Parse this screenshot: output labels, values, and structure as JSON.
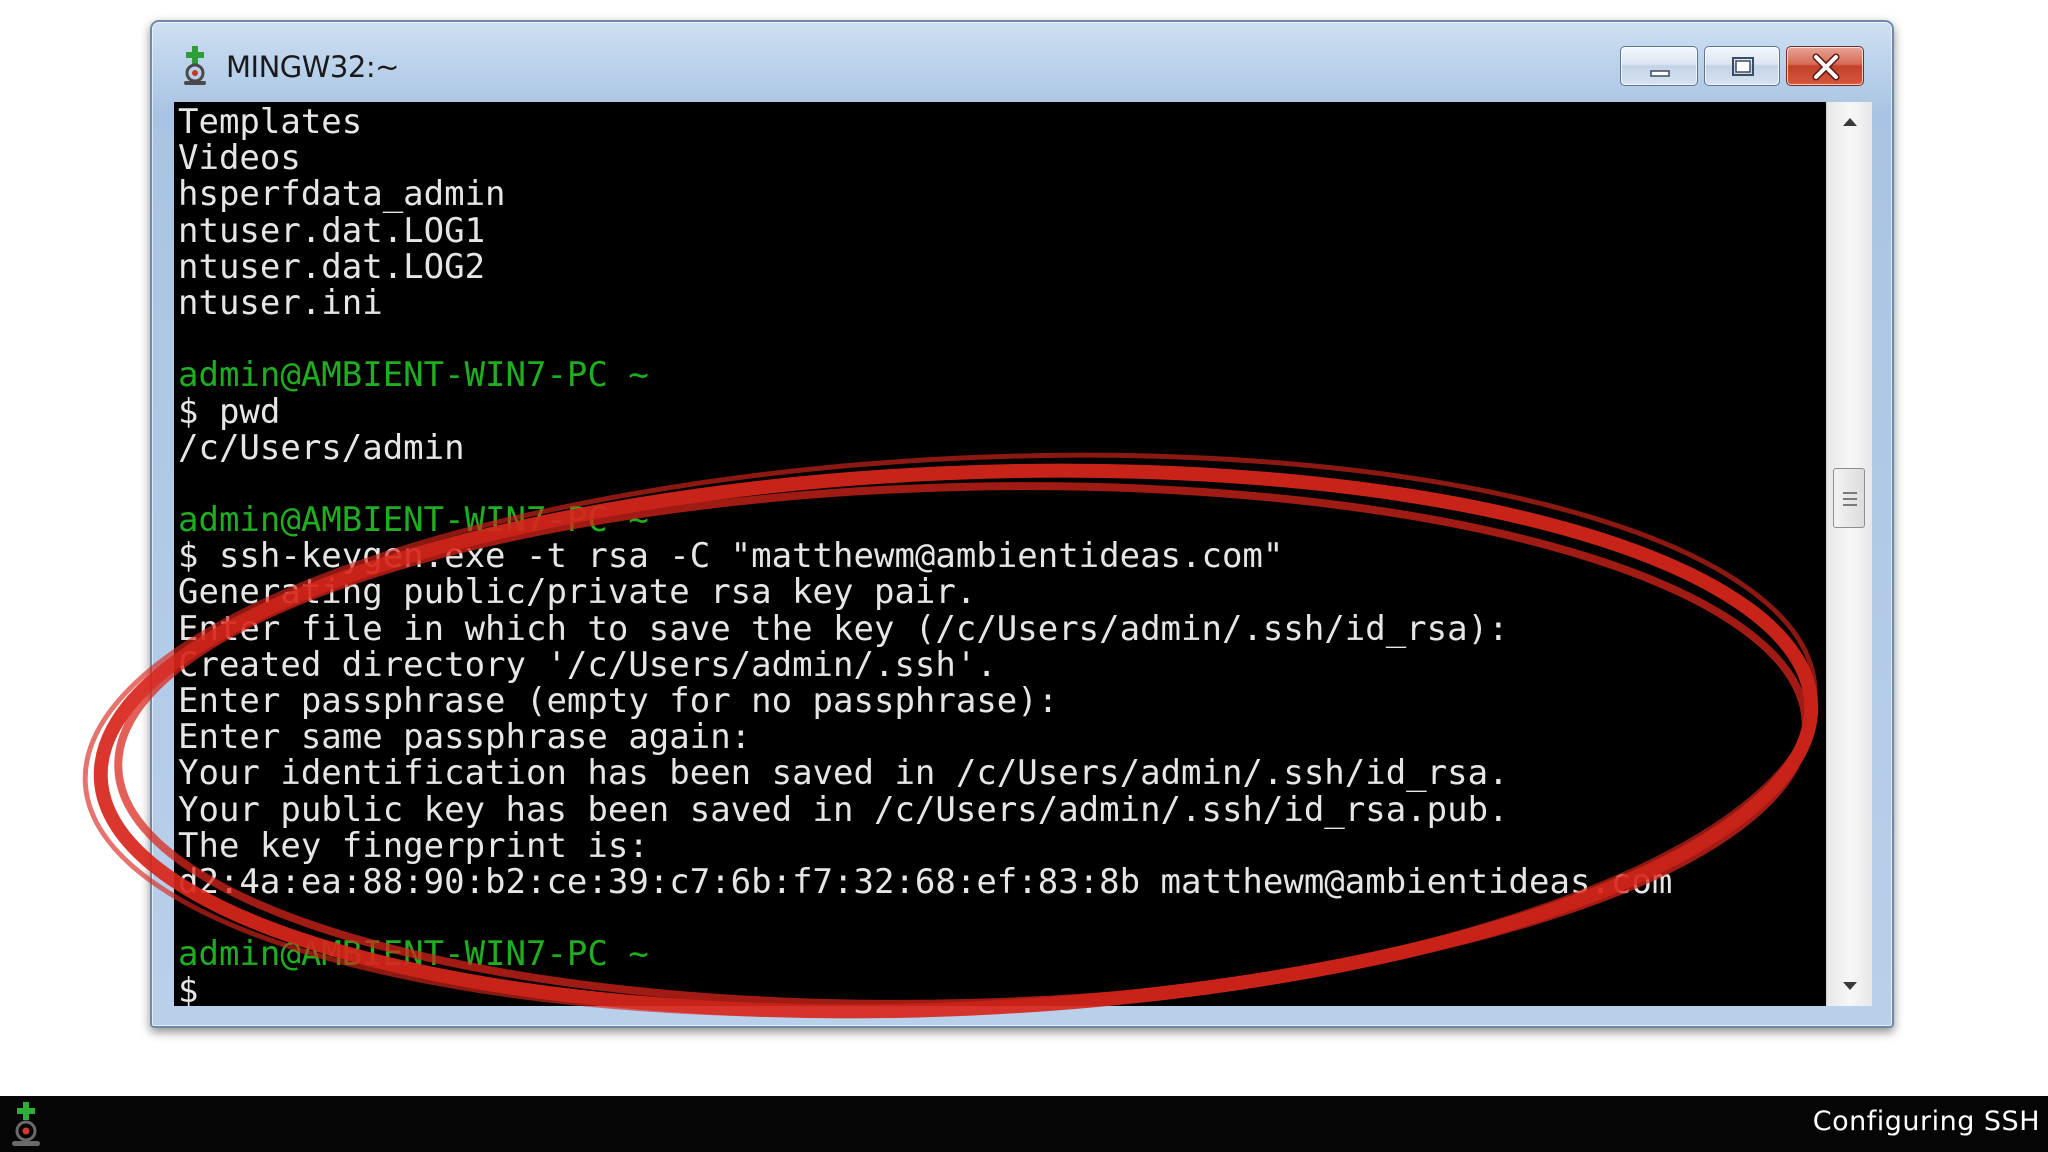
{
  "window": {
    "title": "MINGW32:~",
    "icon": "git-bash-icon",
    "buttons": {
      "minimize": "minimize-icon",
      "maximize": "maximize-icon",
      "close": "close-icon"
    },
    "colors": {
      "close_button": "#c1402a",
      "console_background": "#000000",
      "console_text": "#e6e6e6",
      "prompt_text": "#1fae1f"
    }
  },
  "console": {
    "lines": [
      {
        "text": "Templates",
        "kind": "output"
      },
      {
        "text": "Videos",
        "kind": "output"
      },
      {
        "text": "hsperfdata_admin",
        "kind": "output"
      },
      {
        "text": "ntuser.dat.LOG1",
        "kind": "output"
      },
      {
        "text": "ntuser.dat.LOG2",
        "kind": "output"
      },
      {
        "text": "ntuser.ini",
        "kind": "output"
      },
      {
        "text": "",
        "kind": "blank"
      },
      {
        "text": "admin@AMBIENT-WIN7-PC ~",
        "kind": "prompt"
      },
      {
        "text": "$ pwd",
        "kind": "output"
      },
      {
        "text": "/c/Users/admin",
        "kind": "output"
      },
      {
        "text": "",
        "kind": "blank"
      },
      {
        "text": "admin@AMBIENT-WIN7-PC ~",
        "kind": "prompt"
      },
      {
        "text": "$ ssh-keygen.exe -t rsa -C \"matthewm@ambientideas.com\"",
        "kind": "output"
      },
      {
        "text": "Generating public/private rsa key pair.",
        "kind": "output"
      },
      {
        "text": "Enter file in which to save the key (/c/Users/admin/.ssh/id_rsa):",
        "kind": "output"
      },
      {
        "text": "Created directory '/c/Users/admin/.ssh'.",
        "kind": "output"
      },
      {
        "text": "Enter passphrase (empty for no passphrase):",
        "kind": "output"
      },
      {
        "text": "Enter same passphrase again:",
        "kind": "output"
      },
      {
        "text": "Your identification has been saved in /c/Users/admin/.ssh/id_rsa.",
        "kind": "output"
      },
      {
        "text": "Your public key has been saved in /c/Users/admin/.ssh/id_rsa.pub.",
        "kind": "output"
      },
      {
        "text": "The key fingerprint is:",
        "kind": "output"
      },
      {
        "text": "d2:4a:ea:88:90:b2:ce:39:c7:6b:f7:32:68:ef:83:8b matthewm@ambientideas.com",
        "kind": "output"
      },
      {
        "text": "",
        "kind": "blank"
      },
      {
        "text": "admin@AMBIENT-WIN7-PC ~",
        "kind": "prompt"
      },
      {
        "text": "$",
        "kind": "output"
      }
    ]
  },
  "scrollbar": {
    "up_icon": "scroll-up-arrow-icon",
    "down_icon": "scroll-down-arrow-icon",
    "position": 0.42
  },
  "annotation": {
    "shape": "hand-drawn-ellipse",
    "color": "#d9261c"
  },
  "footer": {
    "logo": "git-logo-icon",
    "caption": "Configuring SSH"
  }
}
